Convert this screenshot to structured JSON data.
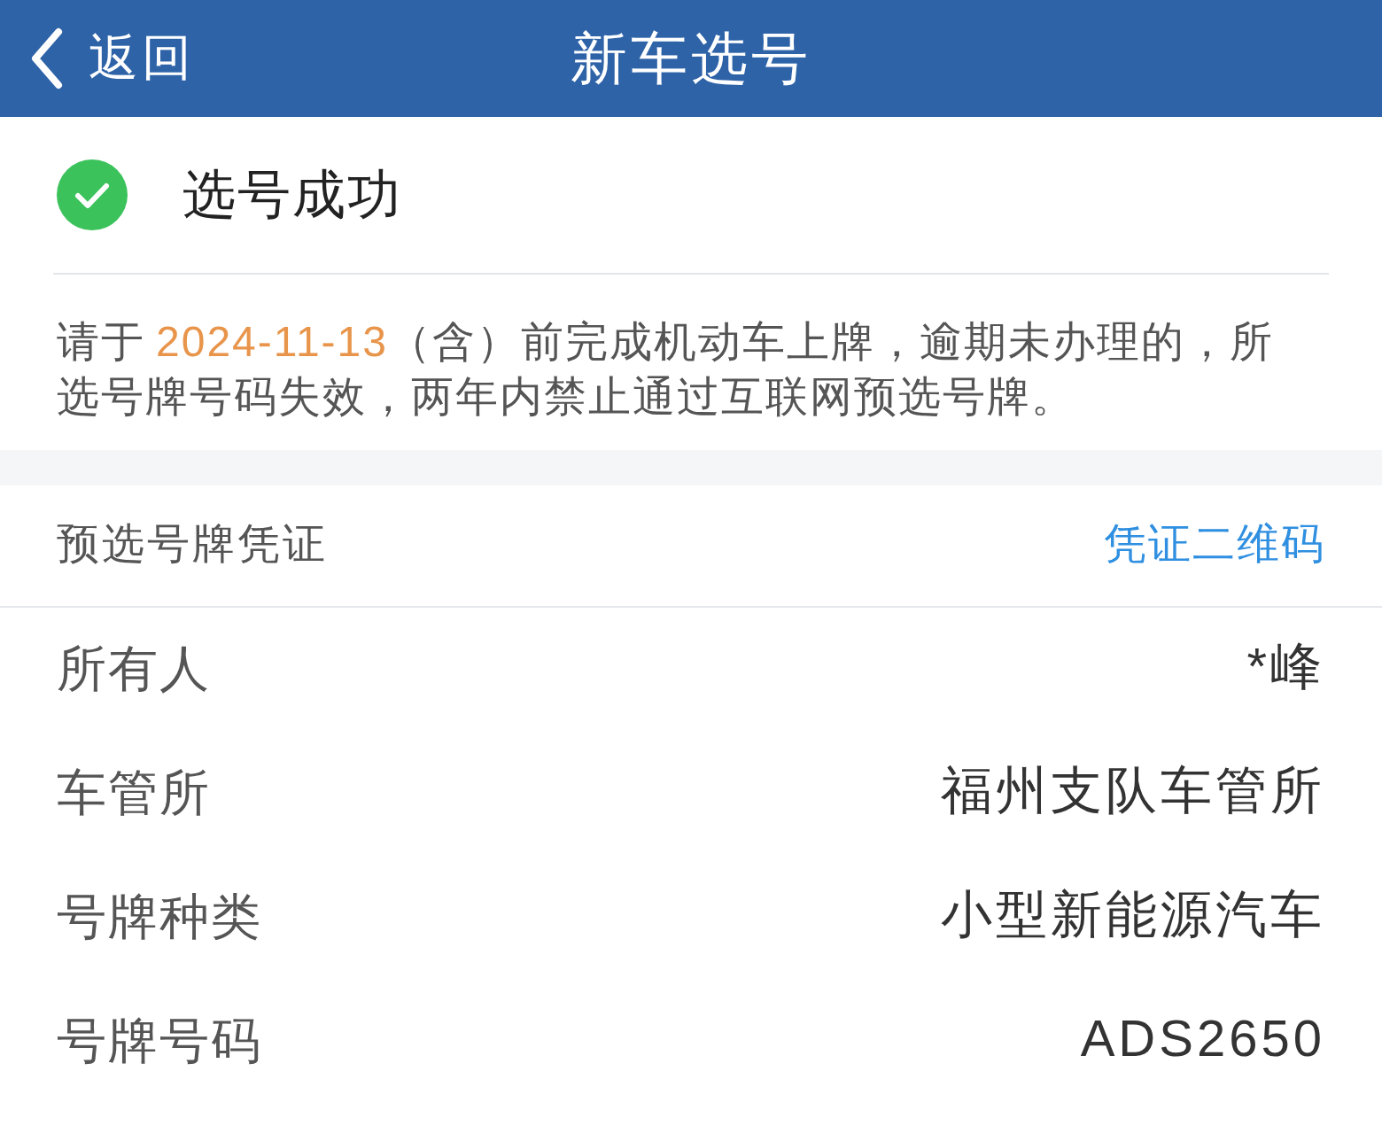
{
  "header": {
    "back_label": "返回",
    "title": "新车选号"
  },
  "result": {
    "kind": "success",
    "title": "选号成功"
  },
  "notice": {
    "text_before": "请于",
    "date": "2024-11-13",
    "text_after": "（含）前完成机动车上牌，逾期未办理的，所选号牌号码失效，两年内禁止通过互联网预选号牌。"
  },
  "voucher": {
    "title": "预选号牌凭证",
    "link": "凭证二维码",
    "fields": [
      {
        "label": "所有人",
        "value": "*峰"
      },
      {
        "label": "车管所",
        "value": "福州支队车管所"
      },
      {
        "label": "号牌种类",
        "value": "小型新能源汽车"
      },
      {
        "label": "号牌号码",
        "value": "ADS2650"
      }
    ]
  }
}
